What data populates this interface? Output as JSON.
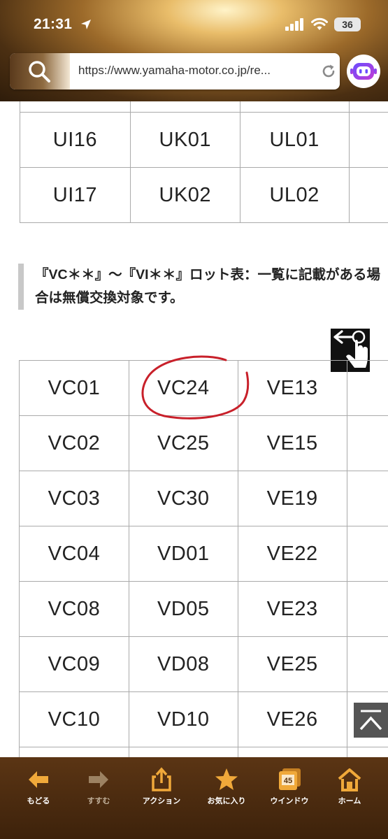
{
  "status_bar": {
    "time": "21:31",
    "battery": "36"
  },
  "browser": {
    "url": "https://www.yamaha-motor.co.jp/re..."
  },
  "table_top": {
    "rows": [
      [
        "",
        "",
        ""
      ],
      [
        "UI16",
        "UK01",
        "UL01"
      ],
      [
        "UI17",
        "UK02",
        "UL02"
      ]
    ]
  },
  "note": {
    "text": "『VC＊＊』〜『VI＊＊』ロット表：一覧に記載がある場合は無償交換対象です。"
  },
  "table_main": {
    "rows": [
      [
        "VC01",
        "VC24",
        "VE13"
      ],
      [
        "VC02",
        "VC25",
        "VE15"
      ],
      [
        "VC03",
        "VC30",
        "VE19"
      ],
      [
        "VC04",
        "VD01",
        "VE22"
      ],
      [
        "VC08",
        "VD05",
        "VE23"
      ],
      [
        "VC09",
        "VD08",
        "VE25"
      ],
      [
        "VC10",
        "VD10",
        "VE26"
      ],
      [
        "",
        "",
        ""
      ]
    ]
  },
  "toolbar": {
    "items": [
      {
        "label": "もどる",
        "icon": "back-arrow-icon"
      },
      {
        "label": "すすむ",
        "icon": "forward-arrow-icon"
      },
      {
        "label": "アクション",
        "icon": "share-icon"
      },
      {
        "label": "お気に入り",
        "icon": "star-icon"
      },
      {
        "label": "ウインドウ",
        "icon": "windows-icon",
        "badge": "45"
      },
      {
        "label": "ホーム",
        "icon": "home-icon"
      }
    ]
  },
  "colors": {
    "toolbar_bg": "#4a2a0e",
    "icon_orange": "#f0a93a",
    "annotation_red": "#c8202a"
  }
}
